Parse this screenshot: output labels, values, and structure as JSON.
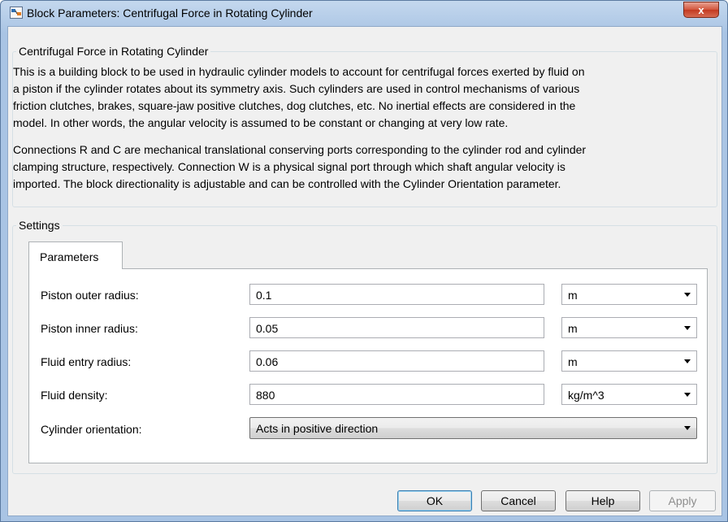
{
  "window": {
    "title": "Block Parameters: Centrifugal Force in Rotating Cylinder",
    "close_label": "x"
  },
  "description": {
    "group_title": "Centrifugal Force in Rotating Cylinder",
    "paragraph1_lines": [
      "This is a building block to be used in hydraulic cylinder models to account for centrifugal forces exerted by fluid on",
      "a piston if the cylinder rotates about its symmetry axis. Such cylinders are used in control mechanisms of various",
      "friction clutches, brakes, square-jaw positive clutches, dog clutches, etc. No inertial effects are considered in the",
      "model. In other words, the angular velocity is assumed to be constant or changing at very low rate."
    ],
    "paragraph2_lines": [
      "Connections R and C are mechanical translational conserving ports corresponding to the cylinder rod and cylinder",
      "clamping structure, respectively. Connection W is a physical signal port through which shaft angular velocity is",
      "imported. The block directionality is adjustable and can be controlled with the Cylinder Orientation parameter."
    ]
  },
  "settings": {
    "group_title": "Settings",
    "tab_label": "Parameters",
    "rows": [
      {
        "label": "Piston outer radius:",
        "value": "0.1",
        "unit": "m"
      },
      {
        "label": "Piston inner radius:",
        "value": "0.05",
        "unit": "m"
      },
      {
        "label": "Fluid entry radius:",
        "value": "0.06",
        "unit": "m"
      },
      {
        "label": "Fluid density:",
        "value": "880",
        "unit": "kg/m^3"
      }
    ],
    "orientation": {
      "label": "Cylinder orientation:",
      "value": "Acts in positive direction"
    }
  },
  "buttons": {
    "ok": "OK",
    "cancel": "Cancel",
    "help": "Help",
    "apply": "Apply"
  },
  "colors": {
    "title_bar": "#b9d1ea",
    "close_button": "#c7432a",
    "dialog_bg": "#f0f0f0"
  }
}
